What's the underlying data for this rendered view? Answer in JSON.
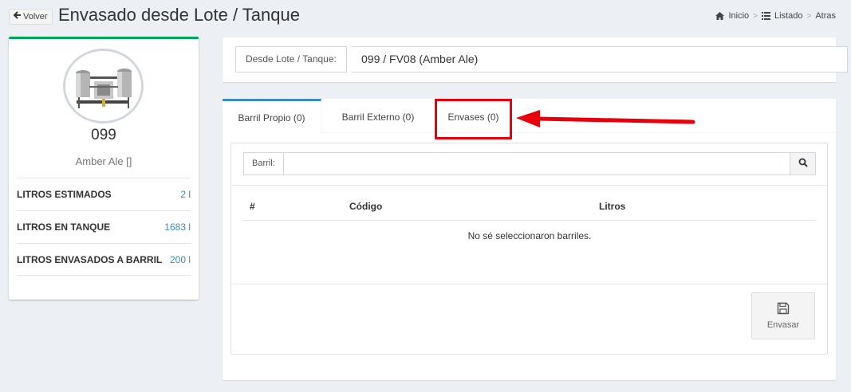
{
  "header": {
    "back_label": "Volver",
    "title": "Envasado desde Lote / Tanque",
    "breadcrumbs": [
      "Inicio",
      "Listado",
      "Atras"
    ]
  },
  "profile": {
    "name": "099",
    "subtitle": "Amber Ale []",
    "stats": [
      {
        "label": "LITROS ESTIMADOS",
        "value": "2 l"
      },
      {
        "label": "LITROS EN TANQUE",
        "value": "1683 l"
      },
      {
        "label": "LITROS ENVASADOS A BARRIL",
        "value": "200 l"
      }
    ]
  },
  "source": {
    "label": "Desde Lote / Tanque:",
    "value": "099 / FV08 (Amber Ale)"
  },
  "tabs": [
    {
      "label": "Barril Propio (0)",
      "active": true
    },
    {
      "label": "Barril Externo (0)",
      "active": false
    },
    {
      "label": "Envases (0)",
      "active": false
    }
  ],
  "search": {
    "label": "Barril:",
    "value": ""
  },
  "table": {
    "columns": [
      "#",
      "Código",
      "Litros"
    ],
    "empty_message": "No sé seleccionaron barriles."
  },
  "save_label": "Envasar",
  "colors": {
    "accent": "#3c8dbc",
    "success": "#00a65a",
    "highlight": "#e8000b"
  },
  "icons": [
    "arrow-left-icon",
    "home-icon",
    "list-icon",
    "search-icon",
    "floppy-disk-icon"
  ]
}
